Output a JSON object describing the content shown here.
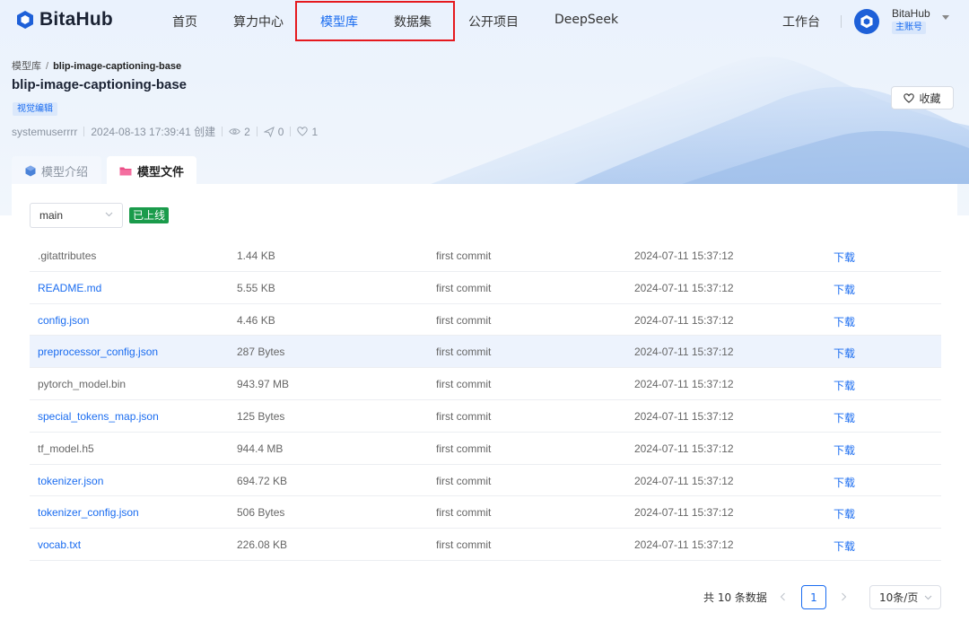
{
  "nav": {
    "brand": "BitaHub",
    "items": [
      {
        "label": "首页",
        "active": false
      },
      {
        "label": "算力中心",
        "active": false
      },
      {
        "label": "模型库",
        "active": true
      },
      {
        "label": "数据集",
        "active": false
      },
      {
        "label": "公开项目",
        "active": false
      },
      {
        "label": "DeepSeek",
        "active": false
      }
    ],
    "workbench": "工作台",
    "user_name": "BitaHub",
    "user_role": "主账号"
  },
  "header": {
    "breadcrumb": [
      "模型库",
      "blip-image-captioning-base"
    ],
    "title": "blip-image-captioning-base",
    "tag": "视觉编辑",
    "author": "systemuserrrr",
    "created": "2024-08-13 17:39:41 创建",
    "views": "2",
    "downloads": "0",
    "likes": "1",
    "favorite_label": "收藏"
  },
  "tabs": [
    {
      "label": "模型介绍",
      "active": false
    },
    {
      "label": "模型文件",
      "active": true
    }
  ],
  "files": {
    "branch": "main",
    "status": "已上线",
    "rows": [
      {
        "name": ".gitattributes",
        "size": "1.44 KB",
        "commit": "first commit",
        "time": "2024-07-11 15:37:12",
        "action": "下载",
        "link": false
      },
      {
        "name": "README.md",
        "size": "5.55 KB",
        "commit": "first commit",
        "time": "2024-07-11 15:37:12",
        "action": "下载",
        "link": true
      },
      {
        "name": "config.json",
        "size": "4.46 KB",
        "commit": "first commit",
        "time": "2024-07-11 15:37:12",
        "action": "下载",
        "link": true
      },
      {
        "name": "preprocessor_config.json",
        "size": "287 Bytes",
        "commit": "first commit",
        "time": "2024-07-11 15:37:12",
        "action": "下载",
        "link": true
      },
      {
        "name": "pytorch_model.bin",
        "size": "943.97 MB",
        "commit": "first commit",
        "time": "2024-07-11 15:37:12",
        "action": "下载",
        "link": false
      },
      {
        "name": "special_tokens_map.json",
        "size": "125 Bytes",
        "commit": "first commit",
        "time": "2024-07-11 15:37:12",
        "action": "下载",
        "link": true
      },
      {
        "name": "tf_model.h5",
        "size": "944.4 MB",
        "commit": "first commit",
        "time": "2024-07-11 15:37:12",
        "action": "下载",
        "link": false
      },
      {
        "name": "tokenizer.json",
        "size": "694.72 KB",
        "commit": "first commit",
        "time": "2024-07-11 15:37:12",
        "action": "下载",
        "link": true
      },
      {
        "name": "tokenizer_config.json",
        "size": "506 Bytes",
        "commit": "first commit",
        "time": "2024-07-11 15:37:12",
        "action": "下载",
        "link": true
      },
      {
        "name": "vocab.txt",
        "size": "226.08 KB",
        "commit": "first commit",
        "time": "2024-07-11 15:37:12",
        "action": "下载",
        "link": true
      }
    ]
  },
  "pagination": {
    "total": "共 10 条数据",
    "page": "1",
    "page_size": "10条/页"
  },
  "colors": {
    "primary": "#1a6cf0",
    "online": "#1a9b4b",
    "highlight_box": "#e5191e",
    "row_highlight": "#edf3fd"
  }
}
